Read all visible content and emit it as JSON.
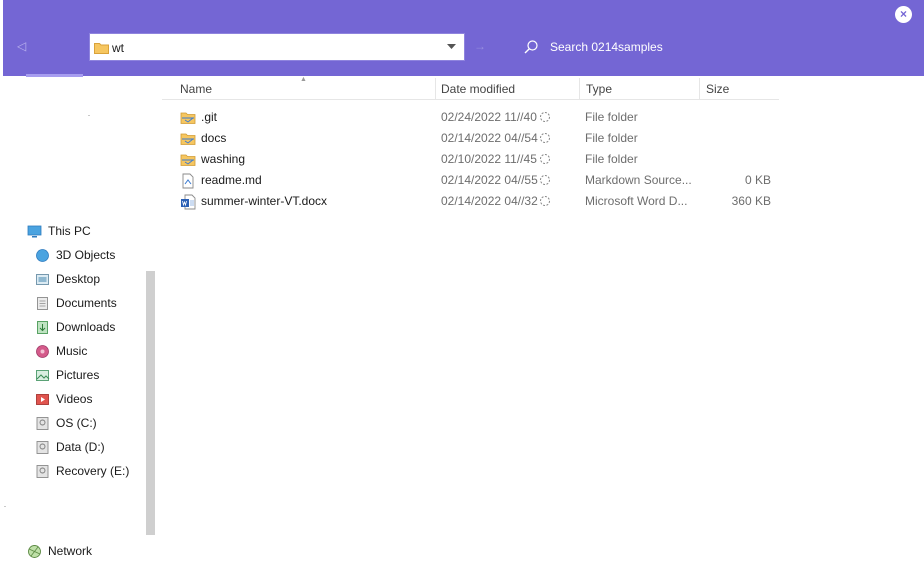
{
  "address": {
    "value": "wt"
  },
  "search": {
    "placeholder": "Search 0214samples"
  },
  "close_symbol": "×",
  "back_symbol": "◁",
  "forward_symbol": "→",
  "columns": [
    {
      "label": "Name"
    },
    {
      "label": "Date modified"
    },
    {
      "label": "Type"
    },
    {
      "label": "Size"
    }
  ],
  "files": [
    {
      "name": ".git",
      "date": "02/24/2022 11//40",
      "type": "File folder",
      "size": "",
      "icon": "folder-icon"
    },
    {
      "name": "docs",
      "date": "02/14/2022 04//54",
      "type": "File folder",
      "size": "",
      "icon": "folder-icon"
    },
    {
      "name": "washing",
      "date": "02/10/2022 11//45",
      "type": "File folder",
      "size": "",
      "icon": "folder-icon"
    },
    {
      "name": "readme.md",
      "date": "02/14/2022 04//55",
      "type": "Markdown Source...",
      "size": "0 KB",
      "icon": "markdown-file-icon"
    },
    {
      "name": "summer-winter-VT.docx",
      "date": "02/14/2022 04//32",
      "type": "Microsoft Word D...",
      "size": "360 KB",
      "icon": "word-document-icon"
    }
  ],
  "sidebar": {
    "this_pc": "This PC",
    "items": [
      {
        "label": "3D Objects",
        "icon": "3d-objects-icon"
      },
      {
        "label": "Desktop",
        "icon": "desktop-icon"
      },
      {
        "label": "Documents",
        "icon": "documents-icon"
      },
      {
        "label": "Downloads",
        "icon": "downloads-icon"
      },
      {
        "label": "Music",
        "icon": "music-icon"
      },
      {
        "label": "Pictures",
        "icon": "pictures-icon"
      },
      {
        "label": "Videos",
        "icon": "videos-icon"
      },
      {
        "label": "OS (C:)",
        "icon": "drive-icon"
      },
      {
        "label": "Data (D:)",
        "icon": "drive-icon"
      },
      {
        "label": "Recovery (E:)",
        "icon": "drive-icon"
      }
    ],
    "network": "Network"
  },
  "colors": {
    "titlebar": "#7466d4",
    "folder": "#f4c35b",
    "accent": "#4a90d9"
  }
}
